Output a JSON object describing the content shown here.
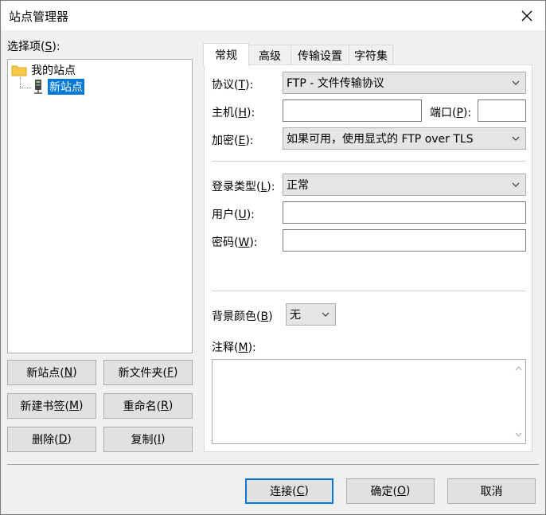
{
  "window": {
    "title": "站点管理器"
  },
  "left": {
    "select_label": "选择项(",
    "select_key": "S",
    "select_suffix": "):",
    "tree": {
      "root": "我的站点",
      "child": "新站点"
    },
    "buttons": {
      "new_site": {
        "text": "新站点(",
        "key": "N",
        "end": ")"
      },
      "new_folder": {
        "text": "新文件夹(",
        "key": "F",
        "end": ")"
      },
      "new_bookmark": {
        "text": "新建书签(",
        "key": "M",
        "end": ")"
      },
      "rename": {
        "text": "重命名(",
        "key": "R",
        "end": ")"
      },
      "delete": {
        "text": "删除(",
        "key": "D",
        "end": ")"
      },
      "copy": {
        "text": "复制(",
        "key": "I",
        "end": ")"
      }
    }
  },
  "tabs": [
    "常规",
    "高级",
    "传输设置",
    "字符集"
  ],
  "general": {
    "protocol": {
      "label": "协议(",
      "key": "T",
      "end": "):",
      "value": "FTP - 文件传输协议"
    },
    "host": {
      "label": "主机(",
      "key": "H",
      "end": "):",
      "value": ""
    },
    "port": {
      "label": "端口(",
      "key": "P",
      "end": "):",
      "value": ""
    },
    "encryption": {
      "label": "加密(",
      "key": "E",
      "end": "):",
      "value": "如果可用，使用显式的 FTP over TLS"
    },
    "logon_type": {
      "label": "登录类型(",
      "key": "L",
      "end": "):",
      "value": "正常"
    },
    "user": {
      "label": "用户(",
      "key": "U",
      "end": "):",
      "value": ""
    },
    "password": {
      "label": "密码(",
      "key": "W",
      "end": "):",
      "value": ""
    },
    "bg_color": {
      "label": "背景颜色(",
      "key": "B",
      "end": ")",
      "value": "无"
    },
    "notes": {
      "label": "注释(",
      "key": "M",
      "end": "):",
      "value": ""
    }
  },
  "footer": {
    "connect": {
      "text": "连接(",
      "key": "C",
      "end": ")"
    },
    "ok": {
      "text": "确定(",
      "key": "O",
      "end": ")"
    },
    "cancel": {
      "text": "取消"
    }
  },
  "colors": {
    "selection": "#0078d7",
    "folder": "#f8c94a"
  }
}
